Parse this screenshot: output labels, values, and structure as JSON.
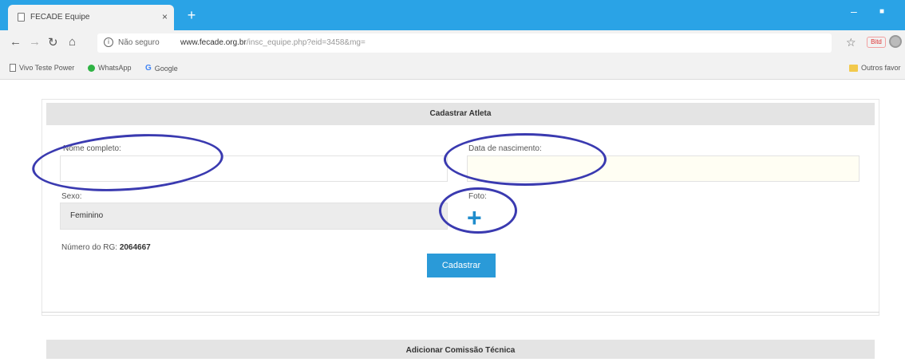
{
  "browser": {
    "tab_title": "FECADE Equipe",
    "tab_close": "×",
    "new_tab": "+",
    "minimize": "–",
    "maximize": "■",
    "security_label": "Não seguro",
    "url_host": "www.fecade.org.br",
    "url_path": "/insc_equipe.php?eid=3458&mg=",
    "extension_label": "Bitd",
    "bookmarks": [
      "Vivo Teste Power",
      "WhatsApp",
      "Google"
    ],
    "other_bookmarks": "Outros favor"
  },
  "form": {
    "title": "Cadastrar Atleta",
    "name_label": "Nome completo:",
    "name_value": "",
    "birth_label": "Data de nascimento:",
    "birth_value": "",
    "sex_label": "Sexo:",
    "sex_value": "Feminino",
    "photo_label": "Foto:",
    "photo_add": "+",
    "rg_label": "Número do RG:",
    "rg_value": "2064667",
    "submit_label": "Cadastrar"
  },
  "section2": {
    "title": "Adicionar Comissão Técnica"
  },
  "colors": {
    "accent": "#2a9ad8",
    "annotation": "#3a3ab0",
    "titlebar": "#2aa3e6"
  }
}
